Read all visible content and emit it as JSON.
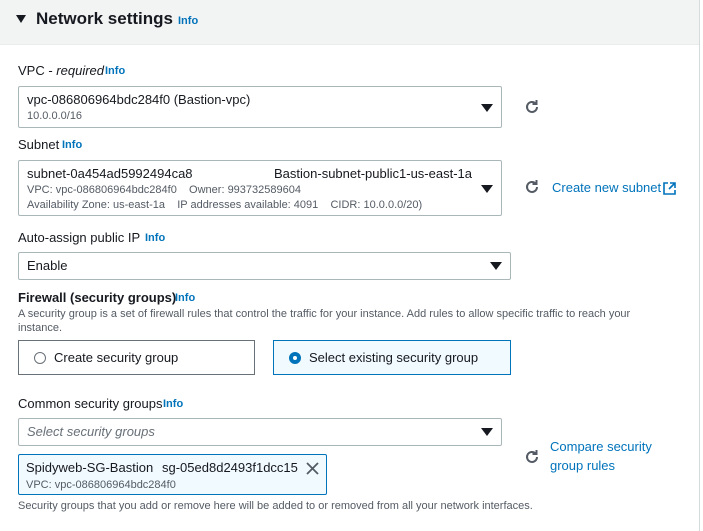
{
  "section": {
    "title": "Network settings",
    "info": "Info"
  },
  "vpc": {
    "label": "VPC - ",
    "label_required": "required",
    "info": "Info",
    "value": "vpc-086806964bdc284f0 (Bastion-vpc)",
    "cidr": "10.0.0.0/16"
  },
  "subnet": {
    "label": "Subnet",
    "info": "Info",
    "id": "subnet-0a454ad5992494ca8",
    "name": "Bastion-subnet-public1-us-east-1a",
    "detail1": "VPC: vpc-086806964bdc284f0    Owner: 993732589604",
    "detail2": "Availability Zone: us-east-1a    IP addresses available: 4091    CIDR: 10.0.0.0/20)",
    "create_link": "Create new subnet"
  },
  "public_ip": {
    "label": "Auto-assign public IP",
    "info": "Info",
    "value": "Enable"
  },
  "firewall": {
    "label": "Firewall (security groups)",
    "info": "Info",
    "description": "A security group is a set of firewall rules that control the traffic for your instance. Add rules to allow specific traffic to reach your instance.",
    "options": [
      {
        "label": "Create security group",
        "selected": false
      },
      {
        "label": "Select existing security group",
        "selected": true
      }
    ]
  },
  "common_sg": {
    "label": "Common security groups",
    "info": "Info",
    "placeholder": "Select security groups",
    "compare_link_line1": "Compare security",
    "compare_link_line2": "group rules",
    "token": {
      "name": "Spidyweb-SG-Bastion",
      "id": "sg-05ed8d2493f1dcc15",
      "vpc": "VPC: vpc-086806964bdc284f0"
    },
    "footer": "Security groups that you add or remove here will be added to or removed from all your network interfaces."
  },
  "colors": {
    "accent": "#0073bb",
    "text": "#16191f",
    "muted": "#545b64",
    "border": "#aab7b8"
  },
  "icons": [
    "caret-down-icon",
    "refresh-icon",
    "external-link-icon",
    "close-icon",
    "radio-icon"
  ]
}
